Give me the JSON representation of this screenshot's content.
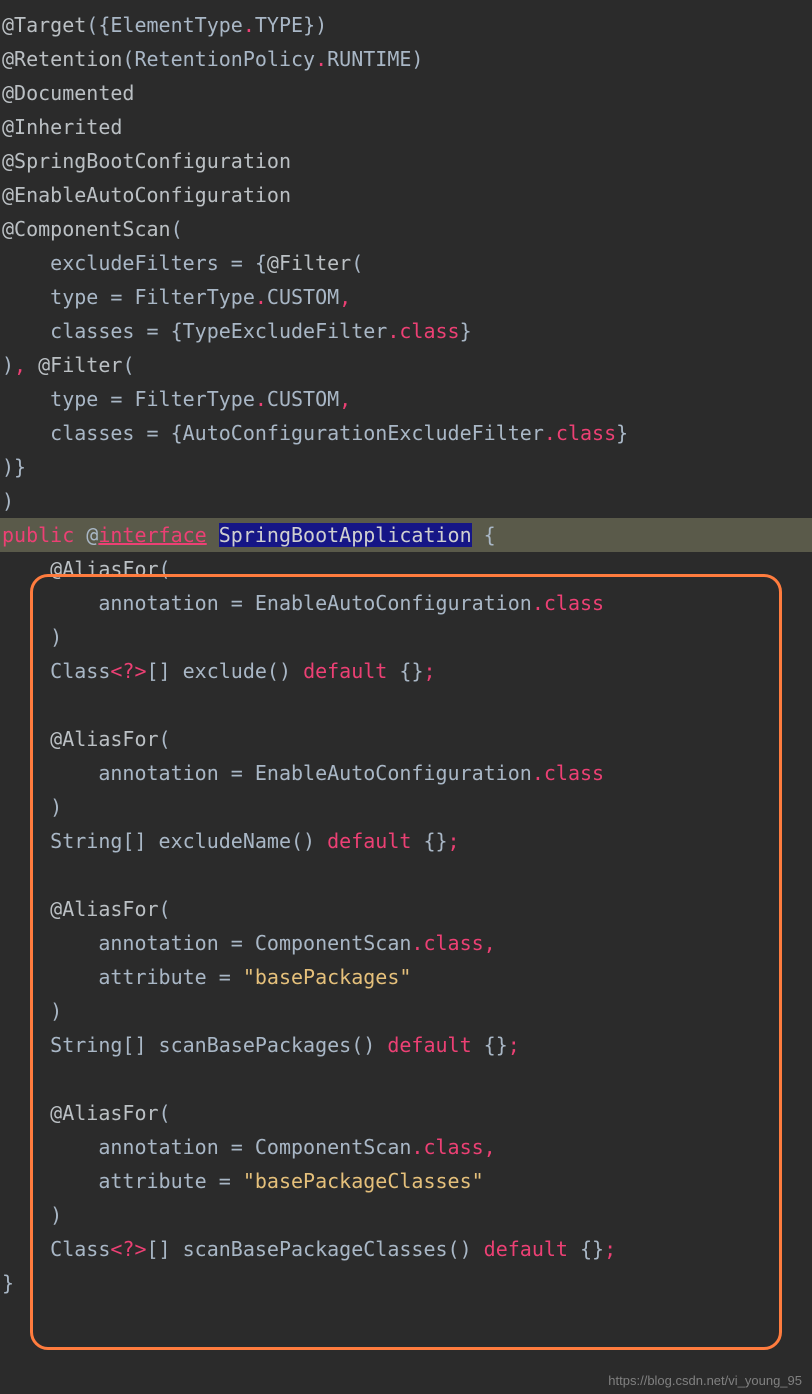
{
  "watermark": "https://blog.csdn.net/vi_young_95",
  "code": {
    "l1": {
      "at": "@Target",
      "p1": "({ElementType",
      "dot": ".",
      "p2": "TYPE",
      "p3": "})"
    },
    "l2": {
      "at": "@Retention",
      "p1": "(RetentionPolicy",
      "dot": ".",
      "p2": "RUNTIME",
      "p3": ")"
    },
    "l3": {
      "at": "@Documented"
    },
    "l4": {
      "at": "@Inherited"
    },
    "l5": {
      "at": "@SpringBootConfiguration"
    },
    "l6": {
      "at": "@EnableAutoConfiguration"
    },
    "l7": {
      "at": "@ComponentScan",
      "p": "("
    },
    "l8": {
      "indent": "    ",
      "a": "excludeFilters = {",
      "at": "@Filter",
      "p": "("
    },
    "l9": {
      "indent": "    ",
      "a": "type = FilterType",
      "dot": ".",
      "b": "CUSTOM",
      "c": ","
    },
    "l10": {
      "indent": "    ",
      "a": "classes = {TypeExcludeFilter",
      "dot": ".",
      "kw": "class",
      "b": "}"
    },
    "l11": {
      "a": ")",
      "c": ",",
      "sp": " ",
      "at": "@Filter",
      "p": "("
    },
    "l12": {
      "indent": "    ",
      "a": "type = FilterType",
      "dot": ".",
      "b": "CUSTOM",
      "c": ","
    },
    "l13": {
      "indent": "    ",
      "a": "classes = {AutoConfigurationExcludeFilter",
      "dot": ".",
      "kw": "class",
      "b": "}"
    },
    "l14": {
      "a": ")}"
    },
    "l15": {
      "a": ")"
    },
    "l16": {
      "kw1": "public",
      "sp": " ",
      "at": "@",
      "kw2": "interface",
      "sp2": " ",
      "sel": "SpringBootApplication",
      "b": " {"
    },
    "l17": {
      "indent": "    ",
      "at": "@AliasFor",
      "p": "("
    },
    "l18": {
      "indent": "        ",
      "a": "annotation = EnableAutoConfiguration",
      "dot": ".",
      "kw": "class"
    },
    "l19": {
      "indent": "    ",
      "a": ")"
    },
    "l20": {
      "indent": "    ",
      "a": "Class",
      "g": "<?>",
      "b": "[] exclude() ",
      "kw": "default",
      "c": " {}",
      "semi": ";"
    },
    "l22": {
      "indent": "    ",
      "at": "@AliasFor",
      "p": "("
    },
    "l23": {
      "indent": "        ",
      "a": "annotation = EnableAutoConfiguration",
      "dot": ".",
      "kw": "class"
    },
    "l24": {
      "indent": "    ",
      "a": ")"
    },
    "l25": {
      "indent": "    ",
      "a": "String[] excludeName() ",
      "kw": "default",
      "c": " {}",
      "semi": ";"
    },
    "l27": {
      "indent": "    ",
      "at": "@AliasFor",
      "p": "("
    },
    "l28": {
      "indent": "        ",
      "a": "annotation = ComponentScan",
      "dot": ".",
      "kw": "class",
      "c": ","
    },
    "l29": {
      "indent": "        ",
      "a": "attribute = ",
      "str": "\"basePackages\""
    },
    "l30": {
      "indent": "    ",
      "a": ")"
    },
    "l31": {
      "indent": "    ",
      "a": "String[] scanBasePackages() ",
      "kw": "default",
      "c": " {}",
      "semi": ";"
    },
    "l33": {
      "indent": "    ",
      "at": "@AliasFor",
      "p": "("
    },
    "l34": {
      "indent": "        ",
      "a": "annotation = ComponentScan",
      "dot": ".",
      "kw": "class",
      "c": ","
    },
    "l35": {
      "indent": "        ",
      "a": "attribute = ",
      "str": "\"basePackageClasses\""
    },
    "l36": {
      "indent": "    ",
      "a": ")"
    },
    "l37": {
      "indent": "    ",
      "a": "Class",
      "g": "<?>",
      "b": "[] scanBasePackageClasses() ",
      "kw": "default",
      "c": " {}",
      "semi": ";"
    },
    "l38": {
      "a": "}"
    }
  }
}
